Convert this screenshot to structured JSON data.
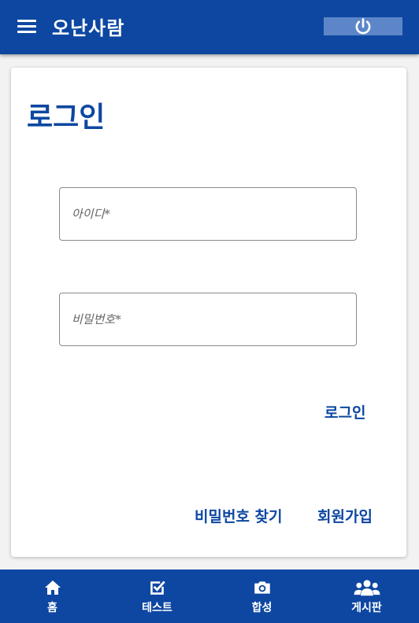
{
  "header": {
    "title": "오난사람",
    "menu_icon": "menu-icon",
    "power_icon": "power-icon"
  },
  "login": {
    "title": "로그인",
    "id_placeholder": "아이디*",
    "id_value": "",
    "password_placeholder": "비밀번호*",
    "password_value": "",
    "submit_label": "로그인",
    "find_password_label": "비밀번호 찾기",
    "signup_label": "회원가입"
  },
  "bottom_nav": {
    "items": [
      {
        "label": "홈",
        "icon": "home-icon"
      },
      {
        "label": "테스트",
        "icon": "checkbox-icon"
      },
      {
        "label": "합성",
        "icon": "camera-icon"
      },
      {
        "label": "게시판",
        "icon": "group-icon"
      }
    ]
  },
  "colors": {
    "primary": "#0d47a1",
    "power_button": "#5d86c8",
    "background": "#f2f2f2"
  }
}
